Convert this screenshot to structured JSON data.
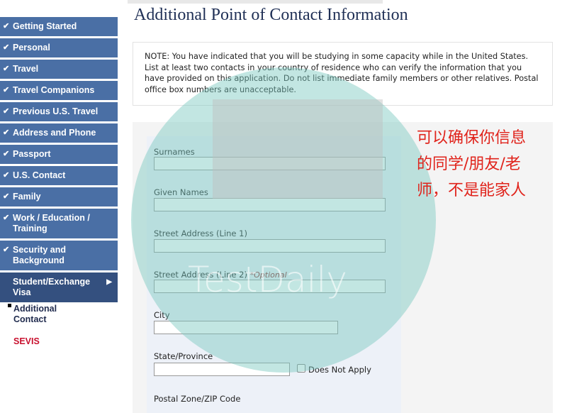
{
  "sidebar": {
    "items": [
      {
        "label": "Getting Started",
        "done": true
      },
      {
        "label": "Personal",
        "done": true
      },
      {
        "label": "Travel",
        "done": true
      },
      {
        "label": "Travel Companions",
        "done": true
      },
      {
        "label": "Previous U.S. Travel",
        "done": true
      },
      {
        "label": "Address and Phone",
        "done": true
      },
      {
        "label": "Passport",
        "done": true
      },
      {
        "label": "U.S. Contact",
        "done": true
      },
      {
        "label": "Family",
        "done": true
      },
      {
        "label": "Work / Education / Training",
        "done": true
      },
      {
        "label": "Security and Background",
        "done": true
      },
      {
        "label": "Student/Exchange Visa",
        "current": true
      }
    ],
    "subitems": [
      {
        "label": "Additional Contact",
        "active": true
      },
      {
        "label": "SEVIS"
      }
    ],
    "check_icon": "✔",
    "arrow_icon": "▶"
  },
  "page": {
    "title": "Additional Point of Contact Information",
    "note": "NOTE: You have indicated that you will be studying in some capacity while in the United States. List at least two contacts in your country of residence who can verify the information that you have provided on this application. Do not list immediate family members or other relatives. Postal office box numbers are unacceptable."
  },
  "form": {
    "surnames": {
      "label": "Surnames",
      "value": ""
    },
    "given_names": {
      "label": "Given Names",
      "value": ""
    },
    "street1": {
      "label": "Street Address (Line 1)",
      "value": ""
    },
    "street2": {
      "label": "Street Address (Line 2)",
      "optional": "*Optional",
      "value": ""
    },
    "city": {
      "label": "City",
      "value": ""
    },
    "state": {
      "label": "State/Province",
      "value": "",
      "does_not_apply": "Does Not Apply"
    },
    "postal": {
      "label": "Postal Zone/ZIP Code"
    }
  },
  "watermark": {
    "text": "TestDaily"
  },
  "annotation": {
    "text": "可以确保你信息的同学/朋友/老师，不是能家人"
  },
  "colors": {
    "nav": "#4a6fa5",
    "nav_current": "#34507f",
    "sevis": "#c8102e",
    "annotation": "#e0231b"
  }
}
